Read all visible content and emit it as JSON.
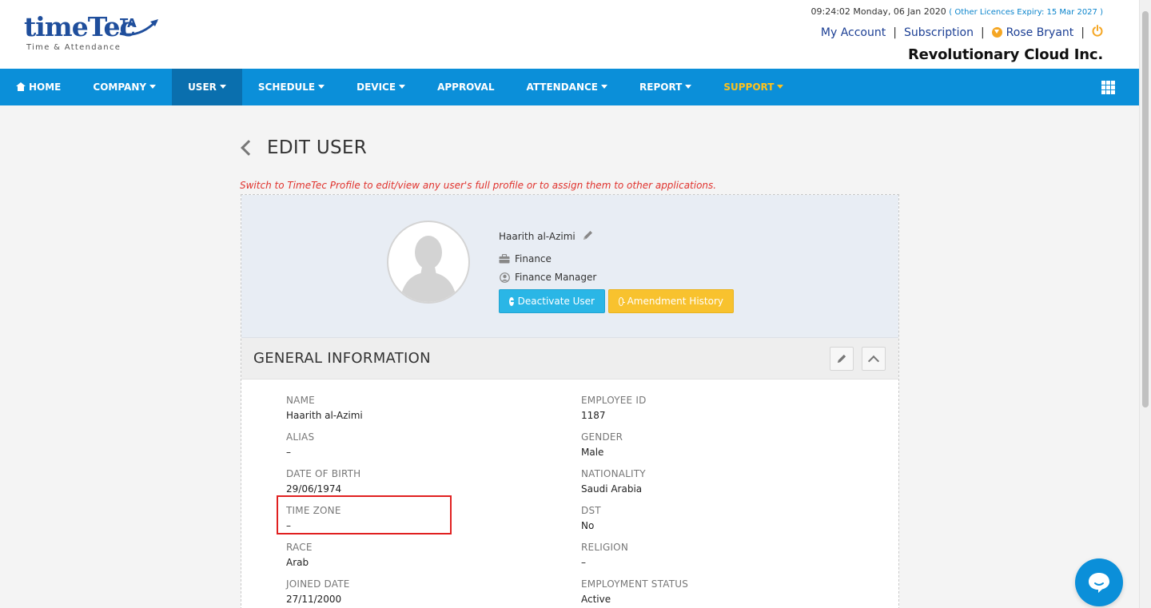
{
  "brand": {
    "word": "timeTec",
    "suffix": "TA",
    "tagline": "Time & Attendance"
  },
  "header": {
    "clock": "09:24:02 Monday, 06 Jan 2020",
    "licence": "( Other Licences Expiry:  15 Mar 2027 )",
    "my_account": "My Account",
    "subscription": "Subscription",
    "user_name": "Rose Bryant",
    "company": "Revolutionary Cloud Inc."
  },
  "nav": {
    "items": [
      {
        "label": "HOME",
        "icon": "home-icon",
        "caret": false
      },
      {
        "label": "COMPANY",
        "caret": true
      },
      {
        "label": "USER",
        "caret": true,
        "active": true
      },
      {
        "label": "SCHEDULE",
        "caret": true
      },
      {
        "label": "DEVICE",
        "caret": true
      },
      {
        "label": "APPROVAL",
        "caret": false
      },
      {
        "label": "ATTENDANCE",
        "caret": true
      },
      {
        "label": "REPORT",
        "caret": true
      },
      {
        "label": "SUPPORT",
        "caret": true,
        "highlight": true
      }
    ],
    "apps_icon": "grid-icon"
  },
  "page": {
    "title": "EDIT USER",
    "switch_message": "Switch to TimeTec Profile to edit/view any user's full profile or to assign them to other applications."
  },
  "profile": {
    "name": "Haarith al-Azimi",
    "department": "Finance",
    "position": "Finance Manager",
    "deactivate_label": "Deactivate User",
    "amendment_label": "Amendment History"
  },
  "general": {
    "title": "GENERAL INFORMATION",
    "fields": [
      {
        "label": "NAME",
        "value": "Haarith al-Azimi"
      },
      {
        "label": "EMPLOYEE ID",
        "value": "1187"
      },
      {
        "label": "ALIAS",
        "value": "–"
      },
      {
        "label": "GENDER",
        "value": "Male"
      },
      {
        "label": "DATE OF BIRTH",
        "value": "29/06/1974"
      },
      {
        "label": "NATIONALITY",
        "value": "Saudi Arabia"
      },
      {
        "label": "TIME ZONE",
        "value": "–"
      },
      {
        "label": "DST",
        "value": "No"
      },
      {
        "label": "RACE",
        "value": "Arab"
      },
      {
        "label": "RELIGION",
        "value": "–"
      },
      {
        "label": "JOINED DATE",
        "value": "27/11/2000"
      },
      {
        "label": "EMPLOYMENT STATUS",
        "value": "Active"
      }
    ]
  },
  "colors": {
    "nav": "#0b8fd9",
    "nav_active": "#0a6fae",
    "support": "#ffc21b",
    "warning_text": "#e0322d",
    "deactivate": "#2ab6e6",
    "amendment": "#f8c22e",
    "highlight_box": "#e02020"
  }
}
